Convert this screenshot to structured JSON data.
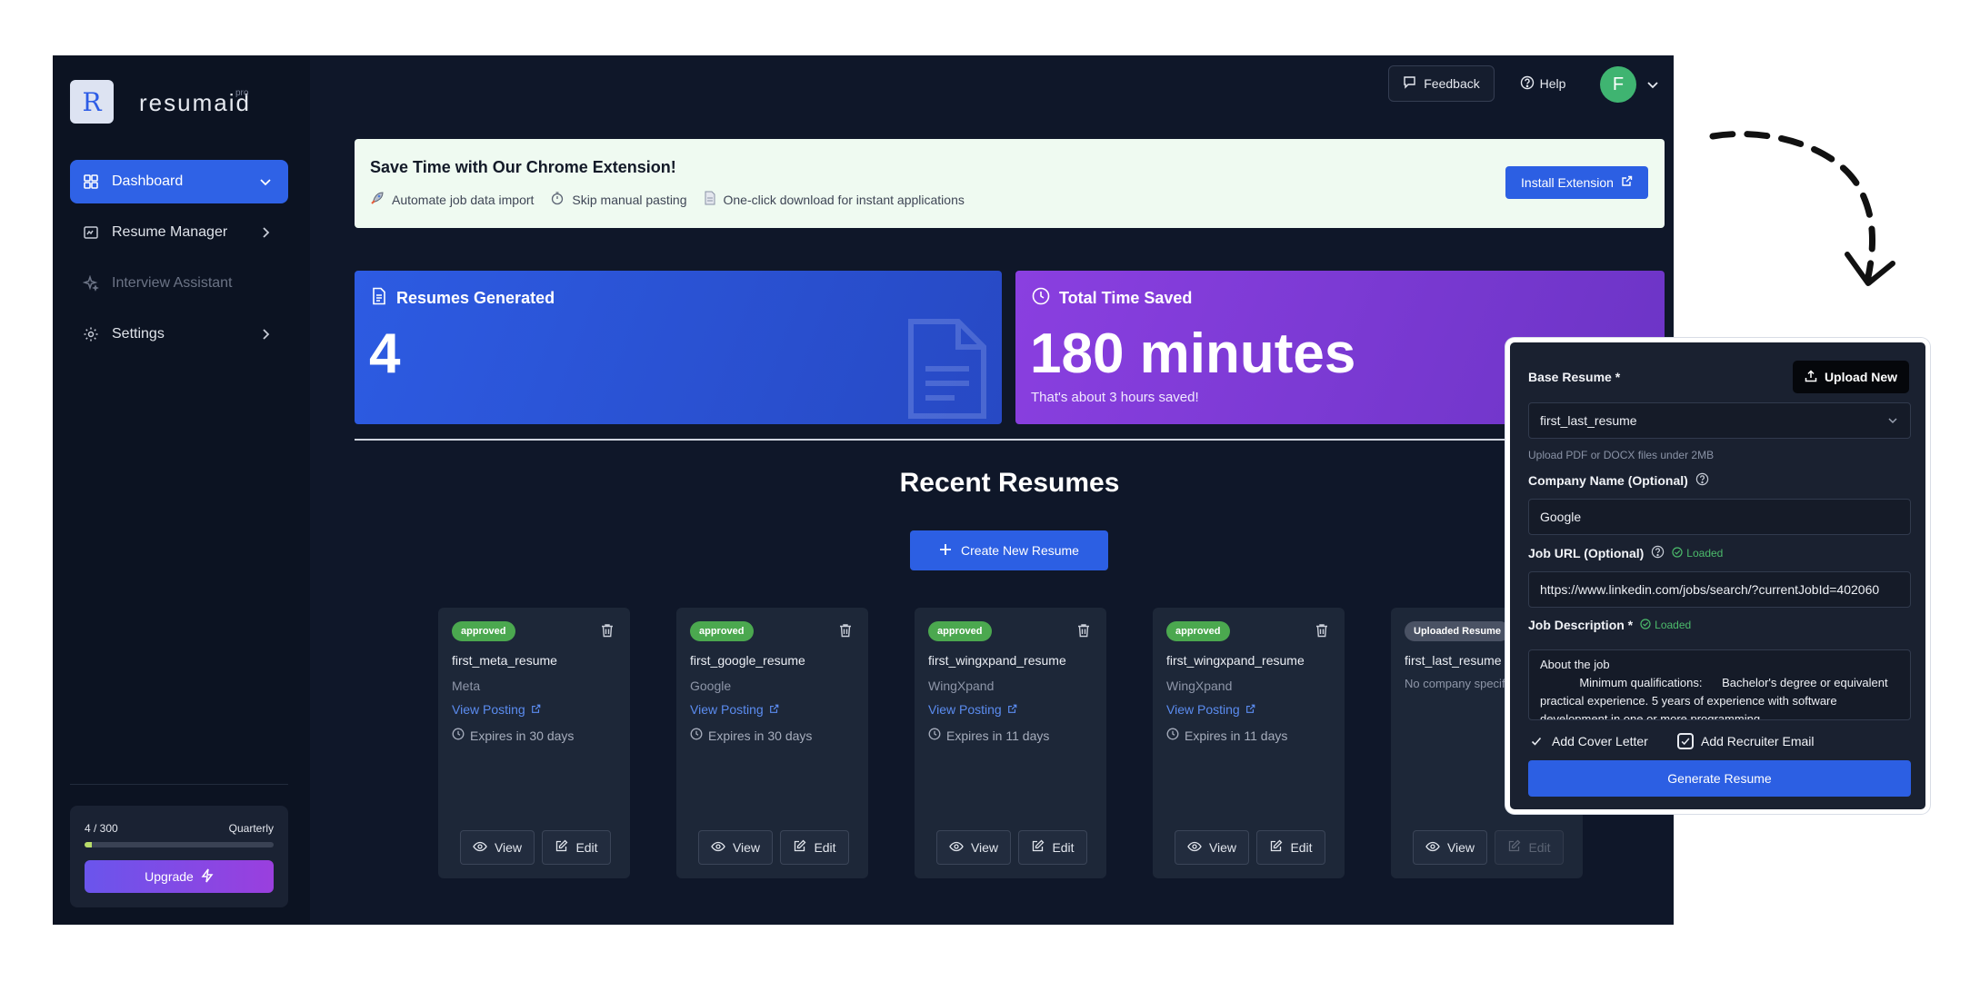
{
  "app": {
    "logo_letter": "R",
    "logo_name": "resumaid",
    "logo_sup": "pro"
  },
  "sidebar": {
    "items": [
      {
        "label": "Dashboard",
        "icon": "dashboard-icon",
        "state": "active"
      },
      {
        "label": "Resume Manager",
        "icon": "resume-icon",
        "state": "normal"
      },
      {
        "label": "Interview Assistant",
        "icon": "sparkle-icon",
        "state": "disabled"
      },
      {
        "label": "Settings",
        "icon": "gear-icon",
        "state": "normal"
      }
    ],
    "usage": {
      "count": "4 / 300",
      "period": "Quarterly",
      "fraction": 0.04,
      "bar_color": "#b8dc6a"
    },
    "upgrade_label": "Upgrade"
  },
  "header": {
    "feedback_label": "Feedback",
    "help_label": "Help",
    "avatar_initial": "F"
  },
  "banner": {
    "title": "Save Time with Our Chrome Extension!",
    "features": [
      "Automate job data import",
      "Skip manual pasting",
      "One-click download for instant applications"
    ],
    "install_label": "Install Extension"
  },
  "stats": {
    "resumes": {
      "label": "Resumes Generated",
      "value": "4"
    },
    "time": {
      "label": "Total Time Saved",
      "value": "180 minutes",
      "sub": "That's about 3 hours saved!"
    }
  },
  "recent": {
    "title": "Recent Resumes",
    "create_label": "Create New Resume",
    "view_label": "View",
    "edit_label": "Edit",
    "cards": [
      {
        "badge": "approved",
        "name": "first_meta_resume",
        "company": "Meta",
        "link": "View Posting",
        "expires": "Expires in 30 days"
      },
      {
        "badge": "approved",
        "name": "first_google_resume",
        "company": "Google",
        "link": "View Posting",
        "expires": "Expires in 30 days"
      },
      {
        "badge": "approved",
        "name": "first_wingxpand_resume",
        "company": "WingXpand",
        "link": "View Posting",
        "expires": "Expires in 11 days"
      },
      {
        "badge": "approved",
        "name": "first_wingxpand_resume",
        "company": "WingXpand",
        "link": "View Posting",
        "expires": "Expires in 11 days"
      },
      {
        "badge": "Uploaded Resume",
        "name": "first_last_resume",
        "company": "No company specified",
        "link": "",
        "expires": ""
      }
    ]
  },
  "panel": {
    "base_resume_label": "Base Resume *",
    "upload_label": "Upload New",
    "base_resume_value": "first_last_resume",
    "upload_hint": "Upload PDF or DOCX files under 2MB",
    "company_label": "Company Name (Optional)",
    "company_value": "Google",
    "job_url_label": "Job URL (Optional)",
    "loaded_label": "Loaded",
    "job_url_value": "https://www.linkedin.com/jobs/search/?currentJobId=402060",
    "job_desc_label": "Job Description *",
    "job_desc_value": "About the job\n            Minimum qualifications:      Bachelor's degree or equivalent practical experience. 5 years of experience with software development in one or more programming",
    "cover_letter_label": "Add Cover Letter",
    "recruiter_label": "Add Recruiter Email",
    "generate_label": "Generate Resume"
  }
}
